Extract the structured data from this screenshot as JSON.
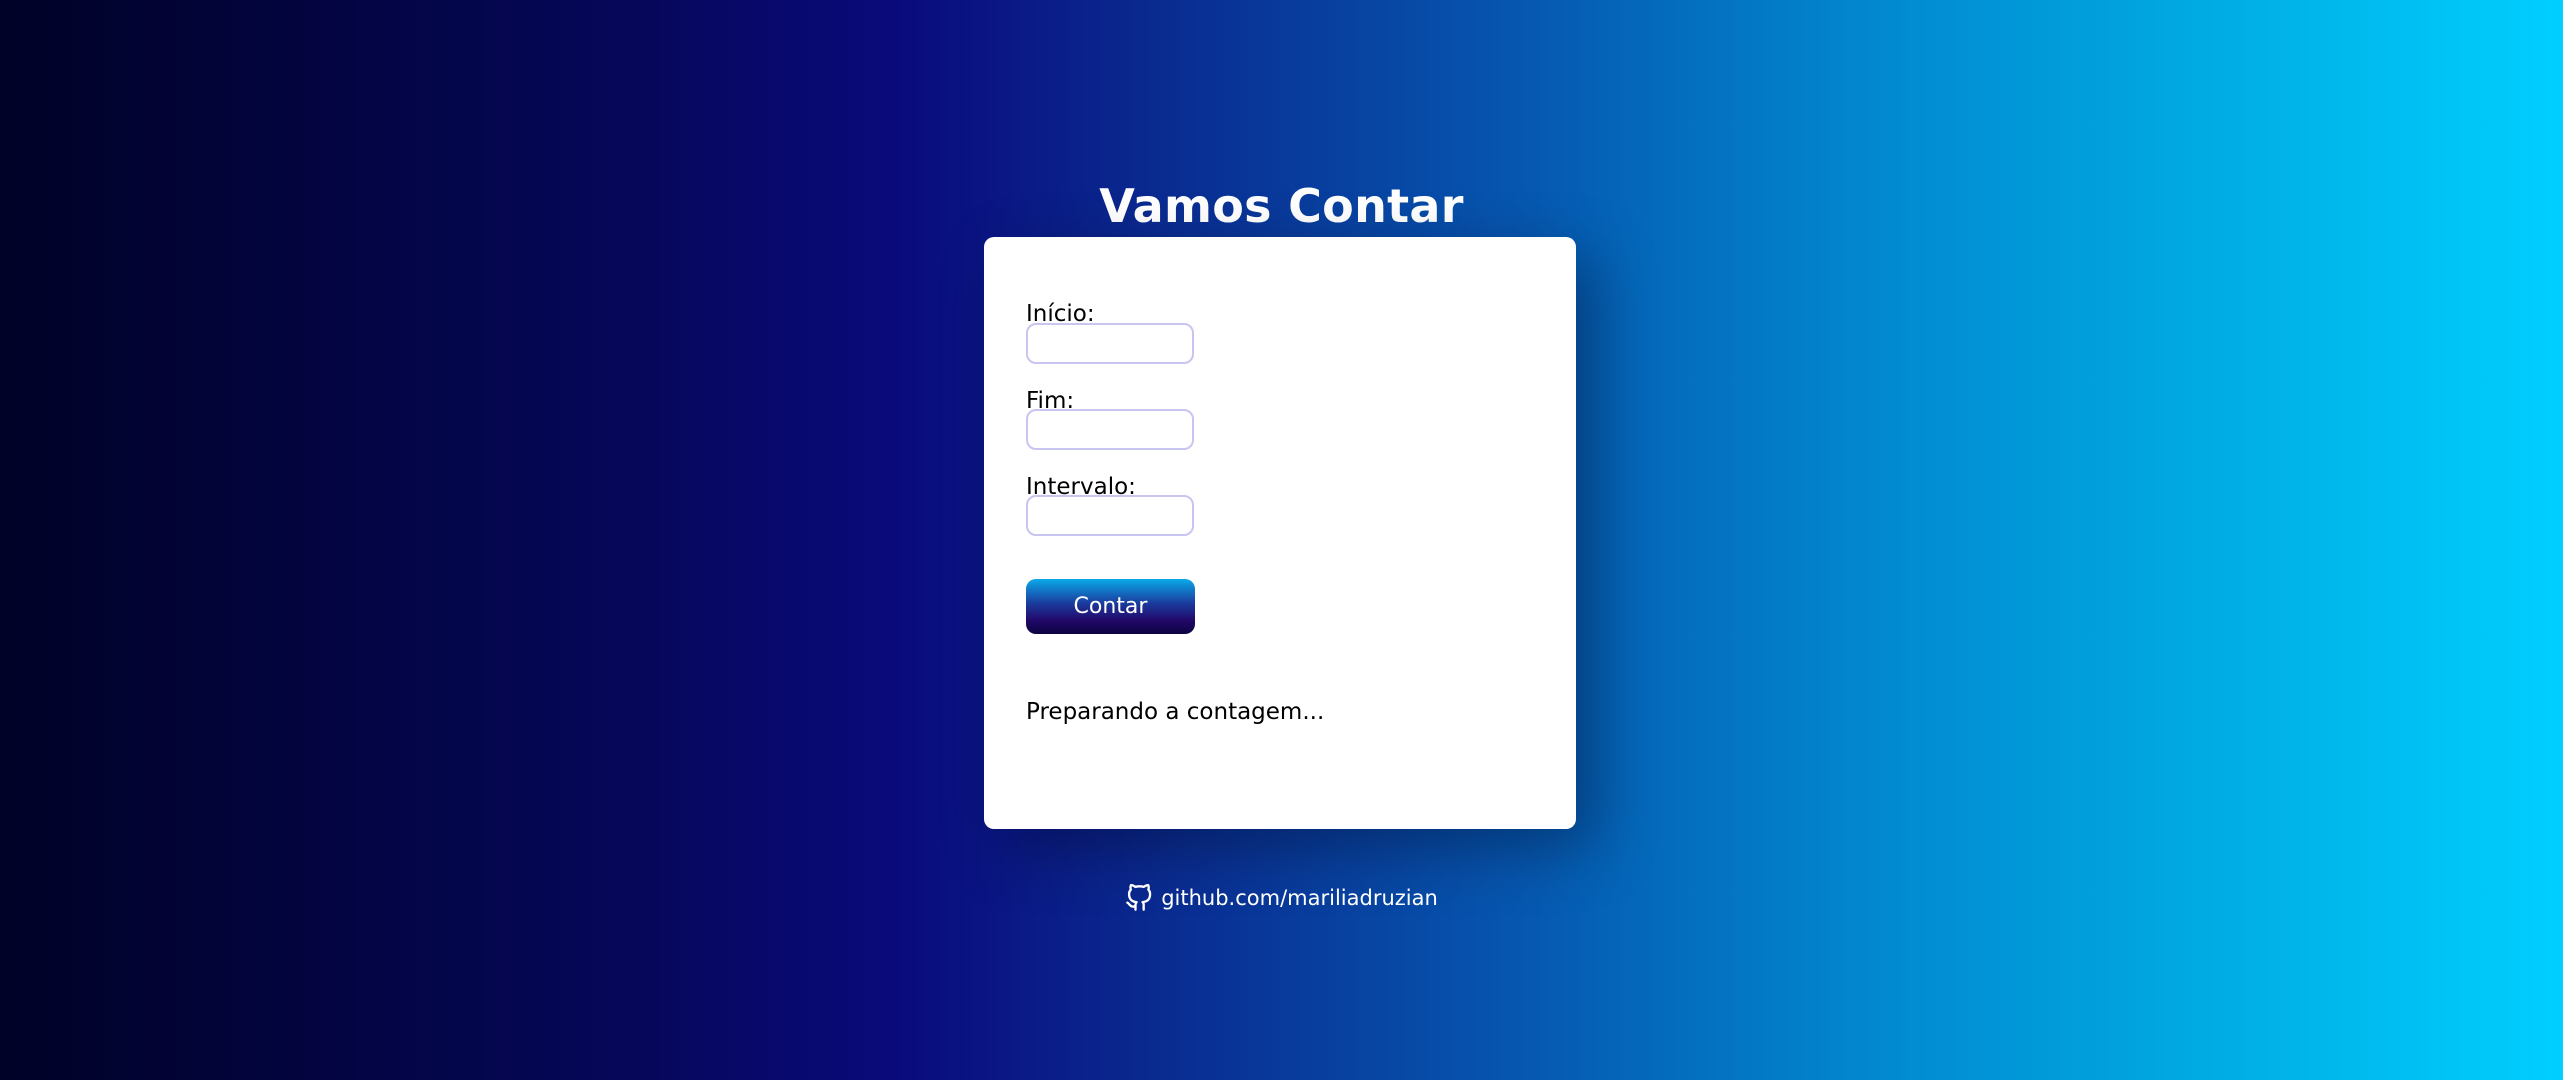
{
  "page": {
    "title": "Vamos Contar"
  },
  "form": {
    "start_label": "Início:",
    "start_value": "",
    "end_label": "Fim:",
    "end_value": "",
    "step_label": "Intervalo:",
    "step_value": "",
    "submit_label": "Contar"
  },
  "result": {
    "status": "Preparando a contagem..."
  },
  "footer": {
    "icon": "github-icon",
    "link_text": "github.com/mariliadruzian"
  },
  "colors": {
    "background_start": "#000227",
    "background_mid": "#0a0a7c",
    "background_end": "#00cfff",
    "card": "#ffffff",
    "input_border": "#c8c5f0",
    "button_top": "#0aa9e8",
    "button_bottom": "#0c0340"
  }
}
